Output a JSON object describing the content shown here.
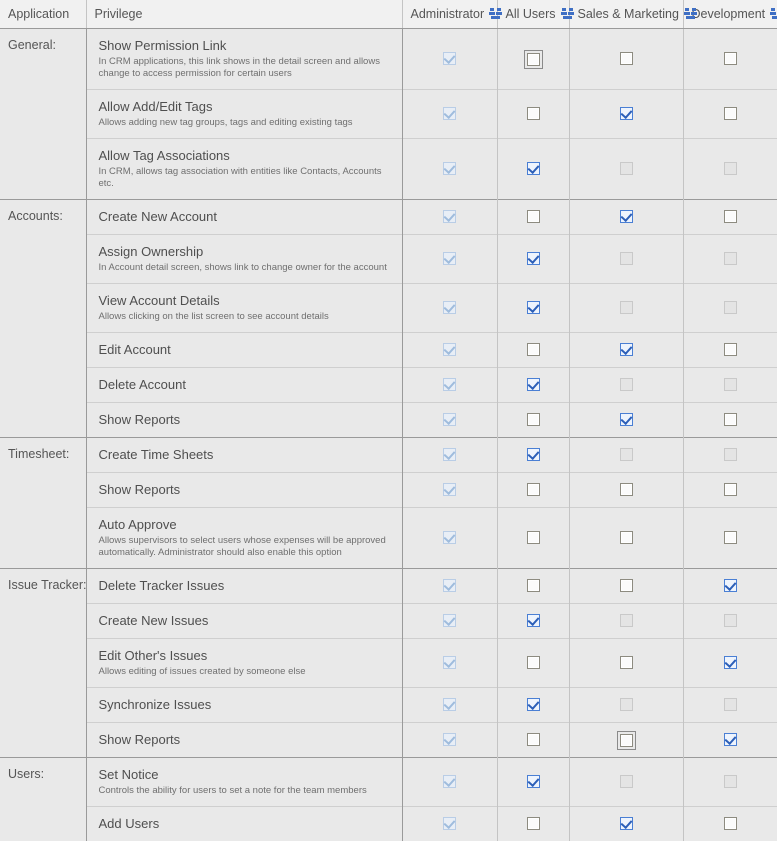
{
  "header": {
    "application": "Application",
    "privilege": "Privilege",
    "groups": [
      {
        "label": "Administrator",
        "icon": "users-group-icon"
      },
      {
        "label": "All Users",
        "icon": "users-group-icon"
      },
      {
        "label": "Sales & Marketing",
        "icon": "users-group-icon"
      },
      {
        "label": "Development",
        "icon": "users-group-icon"
      }
    ]
  },
  "colors": {
    "accent": "#3f6fc4",
    "checkbox_checked_border": "#4a7fd4",
    "checkbox_check_mark": "#2c5fb8",
    "row_background": "#e9e9e9",
    "header_background": "#f1f1f1",
    "group_divider": "#9a9a9a",
    "row_divider": "#cfcfcf",
    "text": "#4f4f4f",
    "muted_text": "#6f6f6f"
  },
  "groups": [
    {
      "name": "General:",
      "rows": [
        {
          "title": "Show Permission Link",
          "desc": "In CRM applications, this link shows in the detail screen and allows change to access permission for certain users",
          "states": [
            "checked-disabled",
            "unchecked",
            "unchecked",
            "unchecked"
          ],
          "focus": [
            false,
            true,
            false,
            false
          ]
        },
        {
          "title": "Allow Add/Edit Tags",
          "desc": "Allows adding new tag groups, tags and editing existing tags",
          "states": [
            "checked-disabled",
            "unchecked",
            "checked",
            "unchecked"
          ],
          "focus": [
            false,
            false,
            false,
            false
          ]
        },
        {
          "title": "Allow Tag Associations",
          "desc": "In CRM, allows tag association with entities like Contacts, Accounts etc.",
          "states": [
            "checked-disabled",
            "checked",
            "unchecked-disabled",
            "unchecked-disabled"
          ],
          "focus": [
            false,
            false,
            false,
            false
          ]
        }
      ]
    },
    {
      "name": "Accounts:",
      "rows": [
        {
          "title": "Create New Account",
          "desc": "",
          "states": [
            "checked-disabled",
            "unchecked",
            "checked",
            "unchecked"
          ],
          "focus": [
            false,
            false,
            false,
            false
          ]
        },
        {
          "title": "Assign Ownership",
          "desc": "In Account detail screen, shows link to change owner for the account",
          "states": [
            "checked-disabled",
            "checked",
            "unchecked-disabled",
            "unchecked-disabled"
          ],
          "focus": [
            false,
            false,
            false,
            false
          ]
        },
        {
          "title": "View Account Details",
          "desc": "Allows clicking on the list screen to see account details",
          "states": [
            "checked-disabled",
            "checked",
            "unchecked-disabled",
            "unchecked-disabled"
          ],
          "focus": [
            false,
            false,
            false,
            false
          ]
        },
        {
          "title": "Edit Account",
          "desc": "",
          "states": [
            "checked-disabled",
            "unchecked",
            "checked",
            "unchecked"
          ],
          "focus": [
            false,
            false,
            false,
            false
          ]
        },
        {
          "title": "Delete Account",
          "desc": "",
          "states": [
            "checked-disabled",
            "checked",
            "unchecked-disabled",
            "unchecked-disabled"
          ],
          "focus": [
            false,
            false,
            false,
            false
          ]
        },
        {
          "title": "Show Reports",
          "desc": "",
          "states": [
            "checked-disabled",
            "unchecked",
            "checked",
            "unchecked"
          ],
          "focus": [
            false,
            false,
            false,
            false
          ]
        }
      ]
    },
    {
      "name": "Timesheet:",
      "rows": [
        {
          "title": "Create Time Sheets",
          "desc": "",
          "states": [
            "checked-disabled",
            "checked",
            "unchecked-disabled",
            "unchecked-disabled"
          ],
          "focus": [
            false,
            false,
            false,
            false
          ]
        },
        {
          "title": "Show Reports",
          "desc": "",
          "states": [
            "checked-disabled",
            "unchecked",
            "unchecked",
            "unchecked"
          ],
          "focus": [
            false,
            false,
            false,
            false
          ]
        },
        {
          "title": "Auto Approve",
          "desc": "Allows supervisors to select users whose expenses will be approved automatically. Administrator should also enable this option",
          "states": [
            "checked-disabled",
            "unchecked",
            "unchecked",
            "unchecked"
          ],
          "focus": [
            false,
            false,
            false,
            false
          ]
        }
      ]
    },
    {
      "name": "Issue Tracker:",
      "rows": [
        {
          "title": "Delete Tracker Issues",
          "desc": "",
          "states": [
            "checked-disabled",
            "unchecked",
            "unchecked",
            "checked"
          ],
          "focus": [
            false,
            false,
            false,
            false
          ]
        },
        {
          "title": "Create New Issues",
          "desc": "",
          "states": [
            "checked-disabled",
            "checked",
            "unchecked-disabled",
            "unchecked-disabled"
          ],
          "focus": [
            false,
            false,
            false,
            false
          ]
        },
        {
          "title": "Edit Other's Issues",
          "desc": "Allows editing of issues created by someone else",
          "states": [
            "checked-disabled",
            "unchecked",
            "unchecked",
            "checked"
          ],
          "focus": [
            false,
            false,
            false,
            false
          ]
        },
        {
          "title": "Synchronize Issues",
          "desc": "",
          "states": [
            "checked-disabled",
            "checked",
            "unchecked-disabled",
            "unchecked-disabled"
          ],
          "focus": [
            false,
            false,
            false,
            false
          ]
        },
        {
          "title": "Show Reports",
          "desc": "",
          "states": [
            "checked-disabled",
            "unchecked",
            "unchecked",
            "checked"
          ],
          "focus": [
            false,
            false,
            true,
            false
          ]
        }
      ]
    },
    {
      "name": "Users:",
      "rows": [
        {
          "title": "Set Notice",
          "desc": "Controls the ability for users to set a note for the team members",
          "states": [
            "checked-disabled",
            "checked",
            "unchecked-disabled",
            "unchecked-disabled"
          ],
          "focus": [
            false,
            false,
            false,
            false
          ]
        },
        {
          "title": "Add Users",
          "desc": "",
          "states": [
            "checked-disabled",
            "unchecked",
            "checked",
            "unchecked"
          ],
          "focus": [
            false,
            false,
            false,
            false
          ]
        }
      ]
    }
  ]
}
